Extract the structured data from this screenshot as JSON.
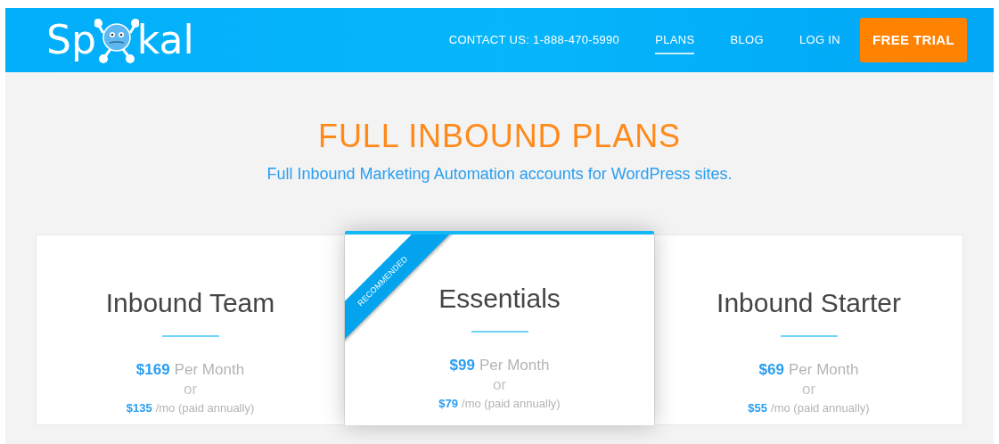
{
  "logo": {
    "before": "Sp",
    "after": "kal"
  },
  "nav": [
    {
      "label": "CONTACT US: 1-888-470-5990",
      "selected": false
    },
    {
      "label": "PLANS",
      "selected": true
    },
    {
      "label": "BLOG",
      "selected": false
    },
    {
      "label": "LOG IN",
      "selected": false
    }
  ],
  "cta": "FREE TRIAL",
  "heading": "FULL INBOUND PLANS",
  "subheading": "Full Inbound Marketing Automation accounts for WordPress sites.",
  "plans": [
    {
      "name": "Inbound Team",
      "recommended": false,
      "monthly_price": "$169",
      "monthly_unit": "Per Month",
      "or": "or",
      "annual_price": "$135",
      "annual_unit": "/mo (paid annually)"
    },
    {
      "name": "Essentials",
      "recommended": true,
      "ribbon": "RECOMMENDED",
      "monthly_price": "$99",
      "monthly_unit": "Per Month",
      "or": "or",
      "annual_price": "$79",
      "annual_unit": "/mo (paid annually)"
    },
    {
      "name": "Inbound Starter",
      "recommended": false,
      "monthly_price": "$69",
      "monthly_unit": "Per Month",
      "or": "or",
      "annual_price": "$55",
      "annual_unit": "/mo (paid annually)"
    }
  ]
}
